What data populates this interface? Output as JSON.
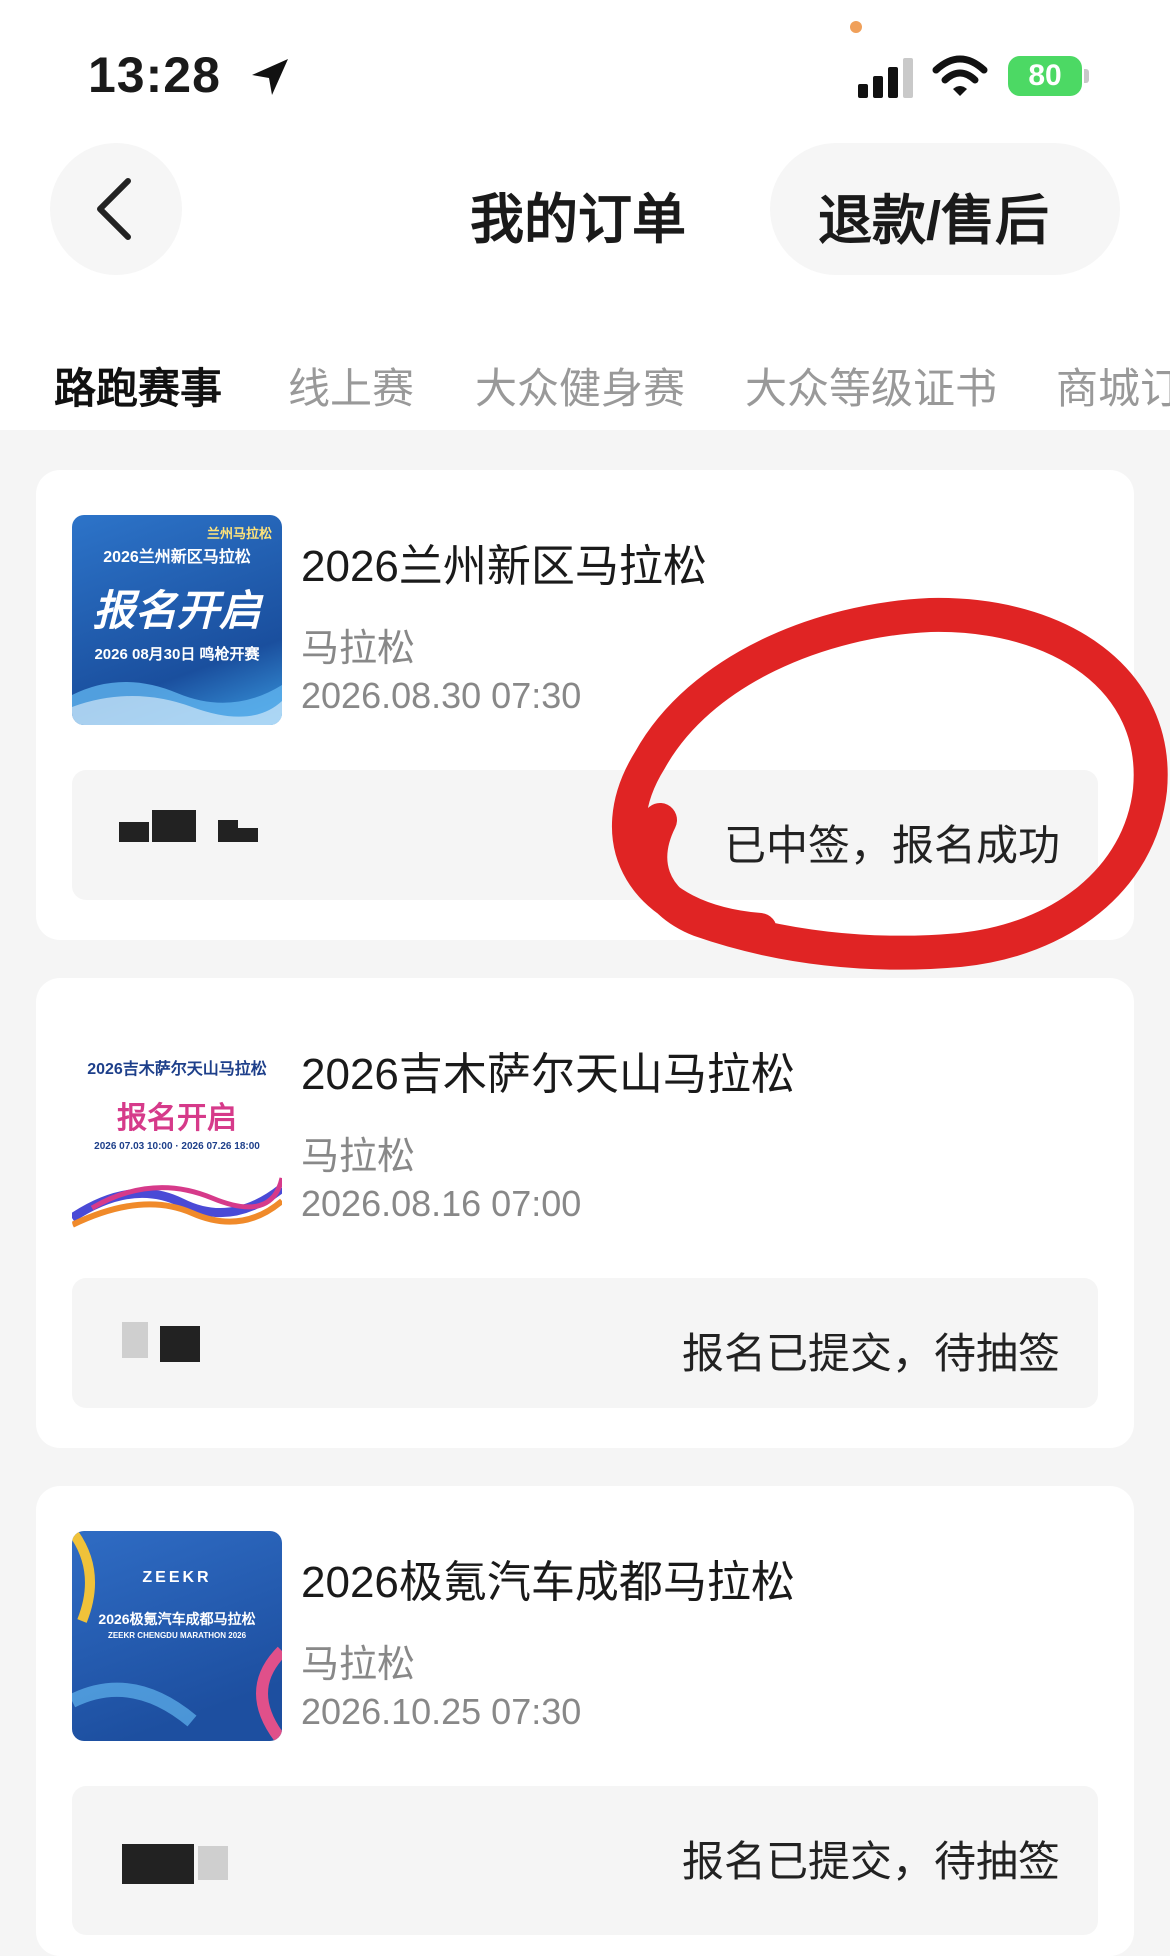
{
  "status_bar": {
    "time": "13:28",
    "battery": "80",
    "icons": [
      "location-arrow-icon",
      "cellular-signal-icon",
      "wifi-icon",
      "battery-icon"
    ]
  },
  "header": {
    "title": "我的订单",
    "refund_button": "退款/售后",
    "back_icon": "chevron-left-icon"
  },
  "tabs": [
    {
      "label": "路跑赛事",
      "active": true
    },
    {
      "label": "线上赛",
      "active": false
    },
    {
      "label": "大众健身赛",
      "active": false
    },
    {
      "label": "大众等级证书",
      "active": false
    },
    {
      "label": "商城订",
      "active": false
    }
  ],
  "orders": [
    {
      "title": "2026兰州新区马拉松",
      "type": "马拉松",
      "date": "2026.08.30 07:30",
      "status": "已中签，报名成功",
      "poster": {
        "heading": "2026兰州新区马拉松",
        "main": "报名开启",
        "sub": "2026 08月30日 鸣枪开赛",
        "brand": "兰州马拉松",
        "colors": [
          "#1f5aa8",
          "#3a86d6"
        ]
      }
    },
    {
      "title": "2026吉木萨尔天山马拉松",
      "type": "马拉松",
      "date": "2026.08.16 07:00",
      "status": "报名已提交，待抽签",
      "poster": {
        "heading": "2026吉木萨尔天山马拉松",
        "main": "报名开启",
        "sub": "2026 07.03 10:00 · 2026 07.26 18:00",
        "colors": [
          "#ffffff",
          "#d63a8a"
        ]
      }
    },
    {
      "title": "2026极氪汽车成都马拉松",
      "type": "马拉松",
      "date": "2026.10.25 07:30",
      "status": "报名已提交，待抽签",
      "poster": {
        "heading": "2026极氪汽车成都马拉松",
        "main": "ZEEKR",
        "sub": "ZEEKR CHENGDU MARATHON 2026",
        "colors": [
          "#1d4fa0",
          "#2f6cc4"
        ]
      }
    }
  ],
  "annotation": {
    "color": "#e02424"
  }
}
